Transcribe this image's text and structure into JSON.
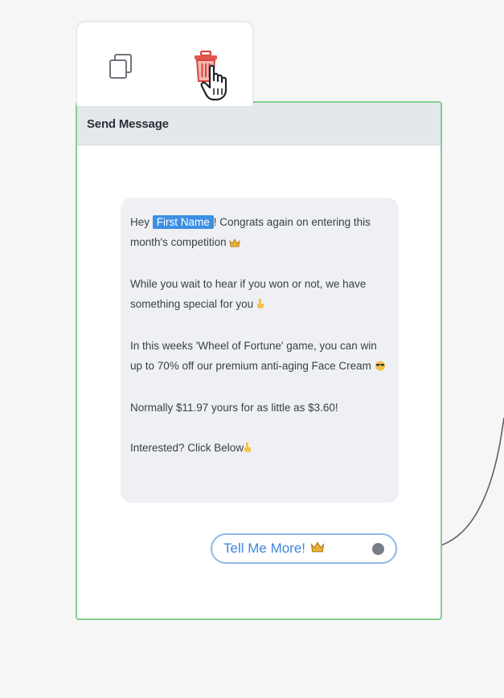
{
  "toolbar": {
    "copy_icon": "copy-icon",
    "delete_icon": "trash-icon"
  },
  "node": {
    "title": "Send Message",
    "message": {
      "p1_before": "Hey ",
      "tag": "First Name",
      "p1_after": "! Congrats again on entering this month's competition",
      "p2": "While you wait to hear if you won or not, we have something special for you",
      "p3": "In this weeks 'Wheel of Fortune' game, you can win up to 70% off our premium anti-aging Face Cream",
      "p4": "Normally $11.97 yours for as little as $3.60!",
      "p5": "Interested? Click Below"
    },
    "button": {
      "label": "Tell Me More!"
    }
  },
  "colors": {
    "node_border": "#7fd08f",
    "header_bg": "#e3e8ec",
    "tag_bg": "#3c8fe3",
    "button_text": "#3b86dd",
    "delete_red": "#e0574f"
  }
}
